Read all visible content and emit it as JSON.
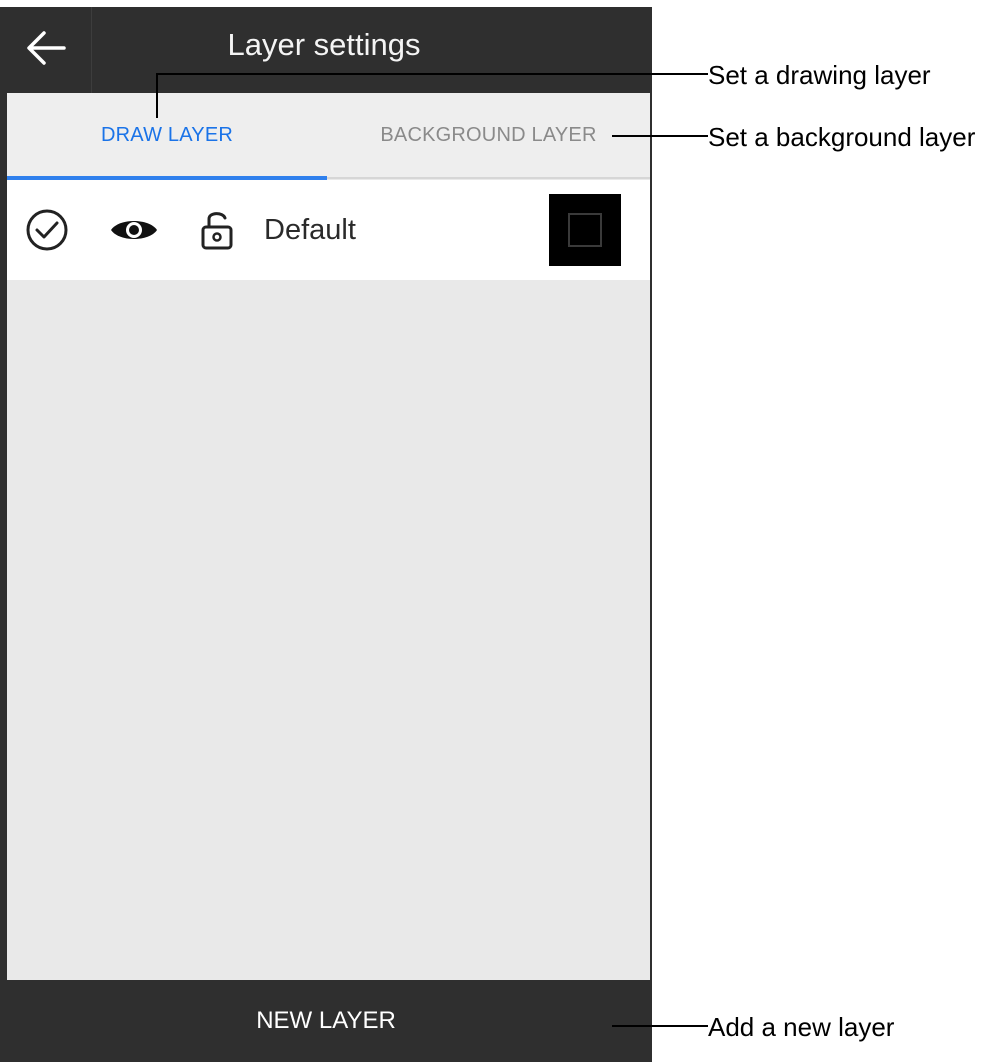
{
  "app_bar": {
    "title": "Layer settings",
    "back_icon": "arrow-left-icon"
  },
  "tabs": [
    {
      "label": "DRAW LAYER",
      "selected": true
    },
    {
      "label": "BACKGROUND LAYER",
      "selected": false
    }
  ],
  "layers": [
    {
      "name": "Default",
      "checked": true,
      "visible": true,
      "locked": false,
      "color": "#000000"
    }
  ],
  "footer": {
    "new_layer_label": "NEW LAYER"
  },
  "callouts": {
    "draw": "Set a drawing layer",
    "background": "Set a background layer",
    "new_layer": "Add a new layer"
  },
  "colors": {
    "bar": "#2f2f2f",
    "accent": "#1a73e8",
    "content_bg": "#e9e9e9",
    "inactive_tab": "#8a8a8a"
  }
}
